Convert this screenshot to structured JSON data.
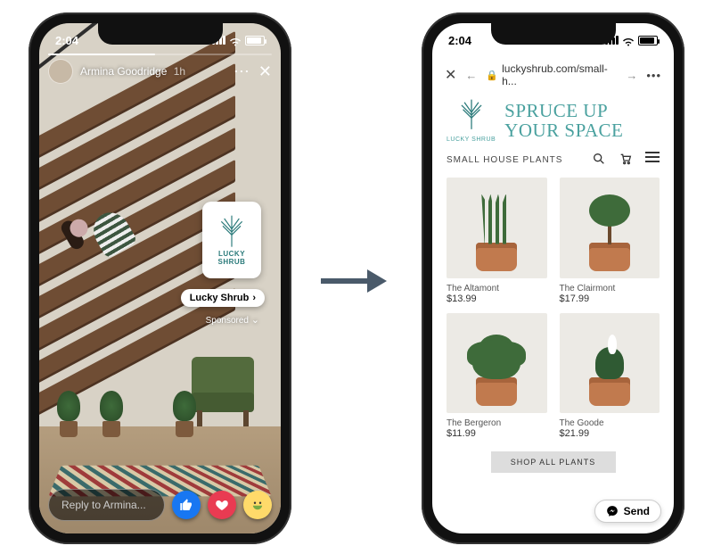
{
  "status": {
    "time": "2:04"
  },
  "story": {
    "poster_name": "Armina Goodridge",
    "posted_ago": "1h",
    "brand_name": "LUCKY",
    "brand_name2": "SHRUB",
    "cta_label": "Lucky Shrub",
    "sponsored_label": "Sponsored",
    "reply_placeholder": "Reply to Armina..."
  },
  "web": {
    "url": "luckyshrub.com/small-h...",
    "brand_small": "LUCKY SHRUB",
    "headline_line1": "SPRUCE UP",
    "headline_line2": "YOUR SPACE",
    "category": "SMALL HOUSE PLANTS",
    "products": [
      {
        "name": "The Altamont",
        "price": "$13.99"
      },
      {
        "name": "The Clairmont",
        "price": "$17.99"
      },
      {
        "name": "The Bergeron",
        "price": "$11.99"
      },
      {
        "name": "The Goode",
        "price": "$21.99"
      }
    ],
    "shop_all": "SHOP ALL PLANTS",
    "send_label": "Send"
  }
}
